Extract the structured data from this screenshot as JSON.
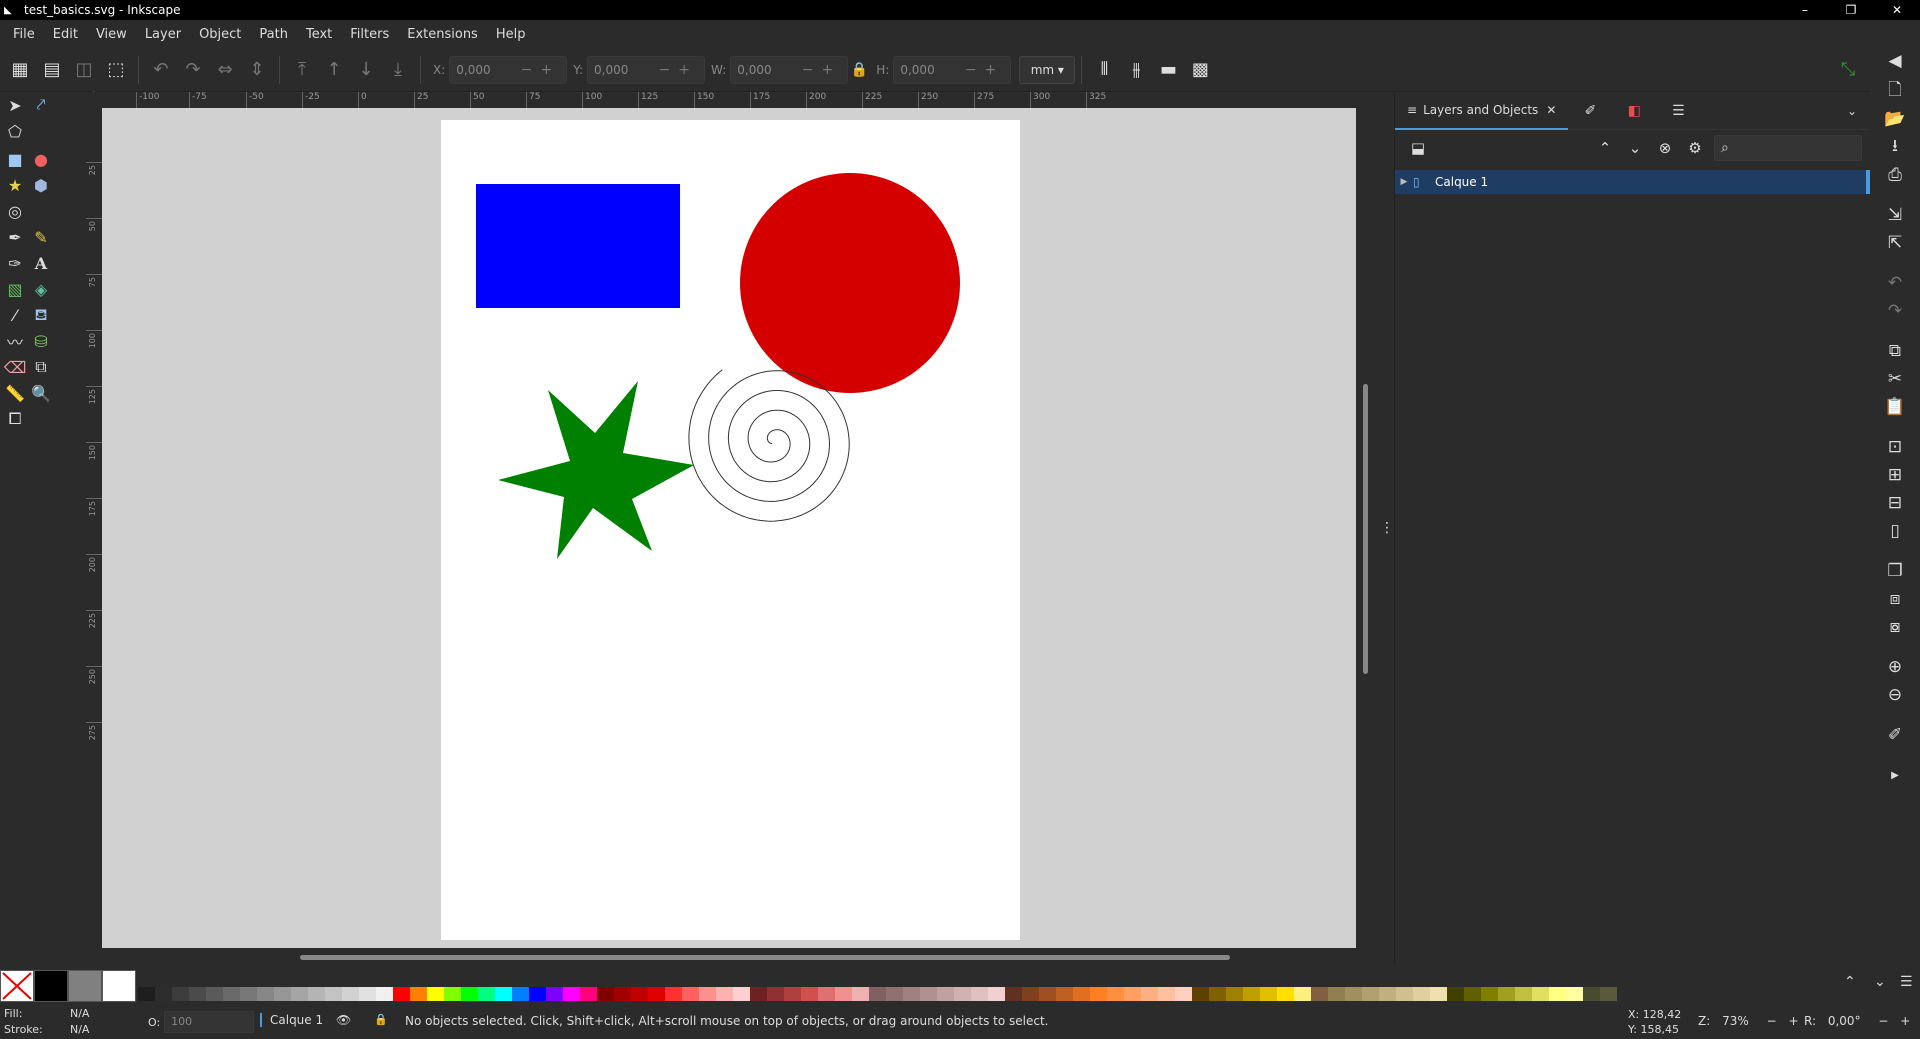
{
  "window": {
    "title": "test_basics.svg - Inkscape",
    "minimize": "–",
    "maximize": "❐",
    "close": "✕"
  },
  "menu": [
    "File",
    "Edit",
    "View",
    "Layer",
    "Object",
    "Path",
    "Text",
    "Filters",
    "Extensions",
    "Help"
  ],
  "toolbar": {
    "x_label": "X:",
    "x_value": "0,000",
    "y_label": "Y:",
    "y_value": "0,000",
    "w_label": "W:",
    "w_value": "0,000",
    "h_label": "H:",
    "h_value": "0,000",
    "unit": "mm",
    "pm": "−+"
  },
  "ruler_top": [
    "-100",
    "-75",
    "-50",
    "-25",
    "0",
    "25",
    "50",
    "75",
    "100",
    "125",
    "150",
    "175",
    "200",
    "225",
    "250",
    "275",
    "300",
    "325"
  ],
  "ruler_left": [
    "25",
    "50",
    "75",
    "100",
    "125",
    "150",
    "175",
    "200",
    "225",
    "250",
    "275"
  ],
  "canvas": {
    "rect_color": "#0000ff",
    "circle_color": "#d40000",
    "star_color": "#008000",
    "spiral_color": "#333333"
  },
  "panel": {
    "tab_title": "Layers and Objects",
    "tab_close": "✕",
    "layer_name": "Calque 1"
  },
  "palette": {
    "colors": [
      "#1e1e1e",
      "#2d2d2d",
      "#3c3c3c",
      "#4b4b4b",
      "#5a5a5a",
      "#696969",
      "#787878",
      "#878787",
      "#969696",
      "#a5a5a5",
      "#b4b4b4",
      "#c3c3c3",
      "#d2d2d2",
      "#e1e1e1",
      "#f0f0f0",
      "#ff0000",
      "#ff8000",
      "#ffff00",
      "#80ff00",
      "#00ff00",
      "#00ff80",
      "#00ffff",
      "#0080ff",
      "#0000ff",
      "#8000ff",
      "#ff00ff",
      "#ff0080",
      "#800000",
      "#a00000",
      "#c00000",
      "#e00000",
      "#ff3030",
      "#ff6060",
      "#ff9090",
      "#ffb0b0",
      "#ffd0d0",
      "#702020",
      "#903030",
      "#b04040",
      "#d05050",
      "#e07070",
      "#f09090",
      "#f0b0b0",
      "#806060",
      "#907070",
      "#a08080",
      "#b09090",
      "#c0a0a0",
      "#d0b0b0",
      "#e0c0c0",
      "#f0d0d0",
      "#603020",
      "#804020",
      "#a05020",
      "#c06020",
      "#e07020",
      "#ff8020",
      "#ff9040",
      "#ffa060",
      "#ffb080",
      "#ffc0a0",
      "#ffd0c0",
      "#604000",
      "#806000",
      "#a08000",
      "#c0a000",
      "#e0c000",
      "#ffe000",
      "#fff080",
      "#806040",
      "#908050",
      "#a09060",
      "#b0a070",
      "#c0b080",
      "#d0c090",
      "#e0d0a0",
      "#f0e0b0",
      "#404000",
      "#606000",
      "#808000",
      "#a0a020",
      "#c0c040",
      "#e0e060",
      "#ffff80",
      "#ffffa0",
      "#4a4a30",
      "#5a5a3a"
    ]
  },
  "status": {
    "fill_label": "Fill:",
    "fill_value": "N/A",
    "stroke_label": "Stroke:",
    "stroke_value": "N/A",
    "opacity_label": "O:",
    "opacity_value": "100",
    "layer": "Calque 1",
    "message": "No objects selected. Click, Shift+click, Alt+scroll mouse on top of objects, or drag around objects to select.",
    "cursor_x": "X:   128,42",
    "cursor_y": "Y:   158,45",
    "zoom_label": "Z:",
    "zoom_value": "73%",
    "rotation_label": "R:",
    "rotation_value": "0,00°"
  }
}
